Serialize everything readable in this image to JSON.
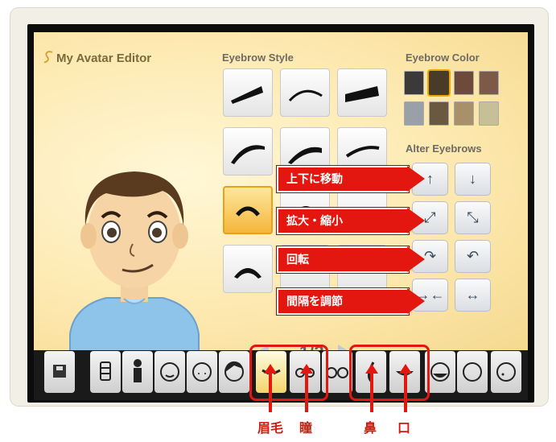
{
  "app": {
    "title": "My Avatar Editor"
  },
  "eyebrow_style": {
    "label": "Eyebrow Style",
    "page": "1/2"
  },
  "eyebrow_color": {
    "label": "Eyebrow Color",
    "swatches": [
      "#3b3a38",
      "#4a3a28",
      "#6e4a3a",
      "#7d5a48",
      "#9aa0a8",
      "#6a5840",
      "#a8906a",
      "#c7bf95"
    ],
    "selected_index": 1
  },
  "alter": {
    "label": "Alter Eyebrows"
  },
  "callouts": {
    "move": "上下に移動",
    "scale": "拡大・縮小",
    "rotate": "回転",
    "spacing": "間隔を調節"
  },
  "bottom_labels": {
    "eyebrow": "眉毛",
    "eye": "瞳",
    "nose": "鼻",
    "mouth": "口"
  },
  "colors": {
    "accent": "#e3170f",
    "selected": "#f4b437"
  }
}
